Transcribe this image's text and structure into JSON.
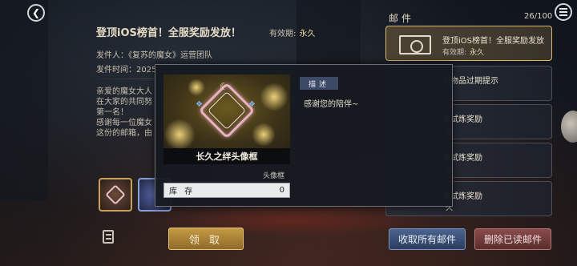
{
  "top": {
    "back_icon": "back-arrow-icon"
  },
  "detail": {
    "title": "登顶iOS榜首！全服奖励发放！",
    "validity_label": "有效期:",
    "validity_value": "永久",
    "sender": "发件人：《复苏的魔女》运营团队",
    "sent_time": "发件时间：2025",
    "body_lines": [
      "亲爱的魔女大人",
      "在大家的共同努",
      "第一名！",
      "感谢每一位魔女",
      "这份的邮箱，由"
    ],
    "claim_label": "领 取"
  },
  "mail_list": {
    "header": "邮件",
    "count": "26/100",
    "items": [
      {
        "title": "登顶iOS榜首！全服奖励发放",
        "validity_label": "有效期:",
        "validity_value": "永久",
        "selected": true
      },
      {
        "title": "力物品过期提示",
        "validity_label": "",
        "validity_value": "",
        "selected": false
      },
      {
        "title": "会试炼奖励",
        "validity_label": "",
        "validity_value": "久",
        "selected": false
      },
      {
        "title": "会试炼奖励",
        "validity_label": "",
        "validity_value": "久",
        "selected": false
      },
      {
        "title": "会试炼奖励",
        "validity_label": "",
        "validity_value": "久",
        "selected": false
      }
    ],
    "collect_all_label": "收取所有邮件",
    "delete_read_label": "删除已读邮件"
  },
  "popup": {
    "item_name": "长久之绊头像框",
    "item_type": "头像框",
    "stock_label": "库 存",
    "stock_value": "0",
    "desc_tag": "描述",
    "desc_text": "感谢您的陪伴~"
  },
  "colors": {
    "gold_button": "#c49a45",
    "blue_button": "#4a6590",
    "red_button": "#8a4b4b",
    "selected_border": "#d6b56e"
  }
}
